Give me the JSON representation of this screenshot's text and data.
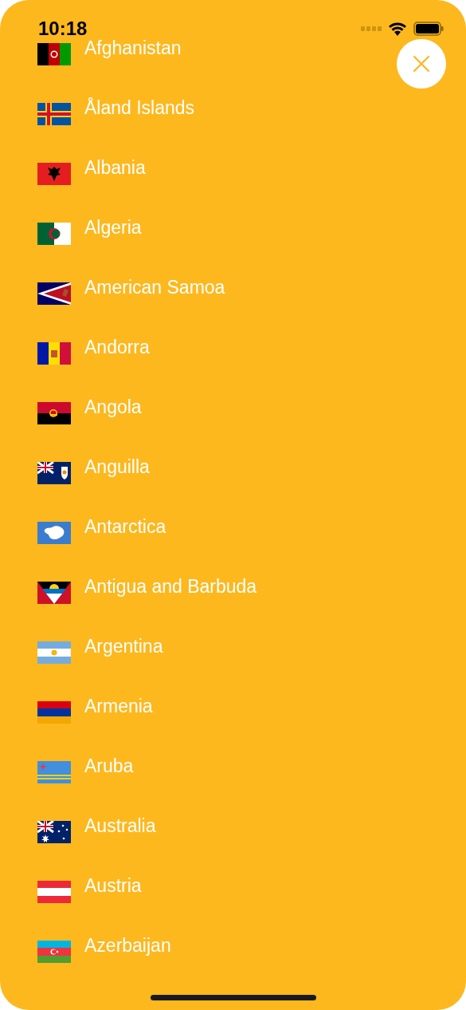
{
  "status_bar": {
    "time": "10:18"
  },
  "countries": [
    {
      "name": "Afghanistan"
    },
    {
      "name": "Åland Islands"
    },
    {
      "name": "Albania"
    },
    {
      "name": "Algeria"
    },
    {
      "name": "American Samoa"
    },
    {
      "name": "Andorra"
    },
    {
      "name": "Angola"
    },
    {
      "name": "Anguilla"
    },
    {
      "name": "Antarctica"
    },
    {
      "name": "Antigua and Barbuda"
    },
    {
      "name": "Argentina"
    },
    {
      "name": "Armenia"
    },
    {
      "name": "Aruba"
    },
    {
      "name": "Australia"
    },
    {
      "name": "Austria"
    },
    {
      "name": "Azerbaijan"
    }
  ]
}
